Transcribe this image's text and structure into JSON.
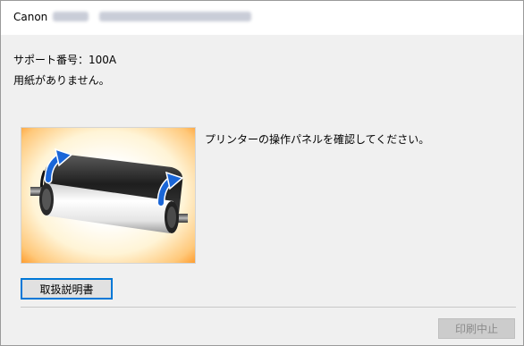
{
  "window": {
    "title_brand": "Canon"
  },
  "message": {
    "support_code_line": "サポート番号：100A",
    "status_text": "用紙がありません。",
    "instruction_text": "プリンターの操作パネルを確認してください。"
  },
  "buttons": {
    "manual_label": "取扱説明書",
    "cancel_label": "印刷中止"
  },
  "image": {
    "icon": "paper-roll-illustration",
    "frame_color": "#ff9e30",
    "arrow_color": "#1a66d8"
  },
  "colors": {
    "focus_border": "#0078d7",
    "disabled_text": "#8c8c8c"
  }
}
